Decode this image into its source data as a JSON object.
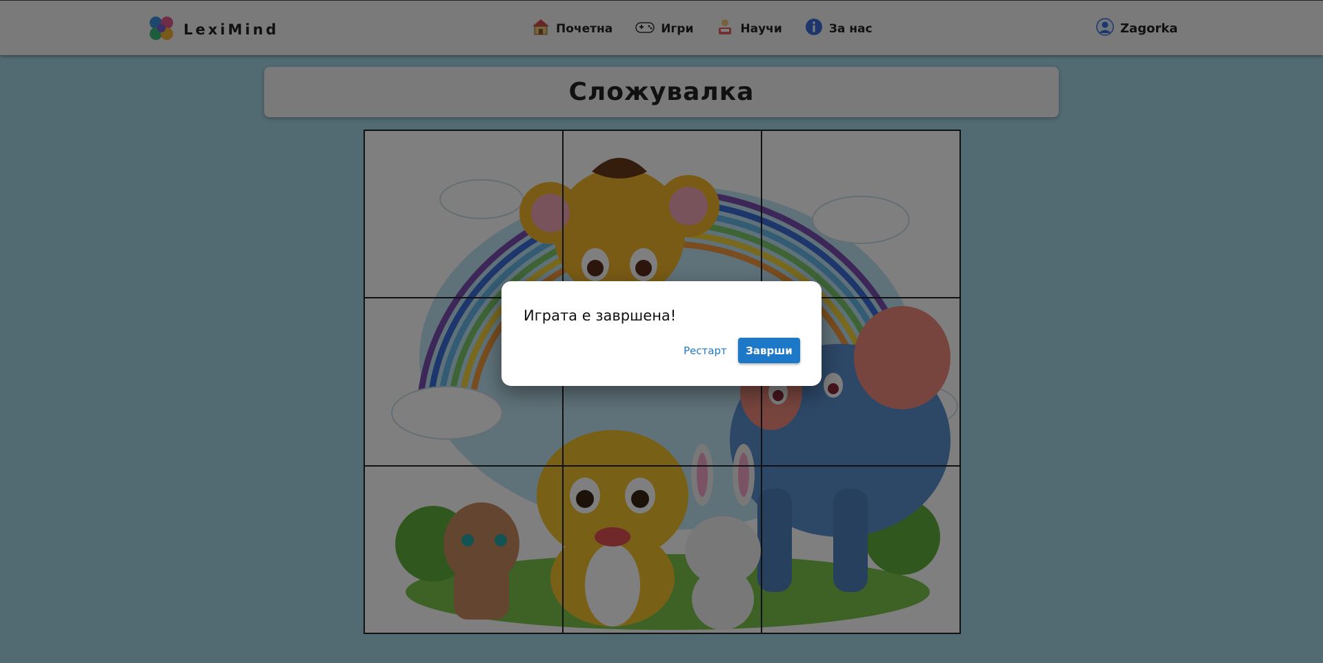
{
  "navbar": {
    "brand": "LexiMind",
    "links": [
      {
        "label": "Почетна",
        "icon": "home-icon"
      },
      {
        "label": "Игри",
        "icon": "gamepad-icon"
      },
      {
        "label": "Научи",
        "icon": "learn-icon"
      },
      {
        "label": "За нас",
        "icon": "info-icon"
      }
    ],
    "user": "Zagorka"
  },
  "page": {
    "title": "Сложувалка"
  },
  "puzzle": {
    "image": "cartoon animals with rainbow",
    "grid": [
      3,
      3
    ]
  },
  "dialog": {
    "message": "Играта е завршена!",
    "restart_label": "Рестарт",
    "finish_label": "Заврши"
  },
  "colors": {
    "background": "#a4d4e3",
    "accent": "#1e78c8"
  }
}
